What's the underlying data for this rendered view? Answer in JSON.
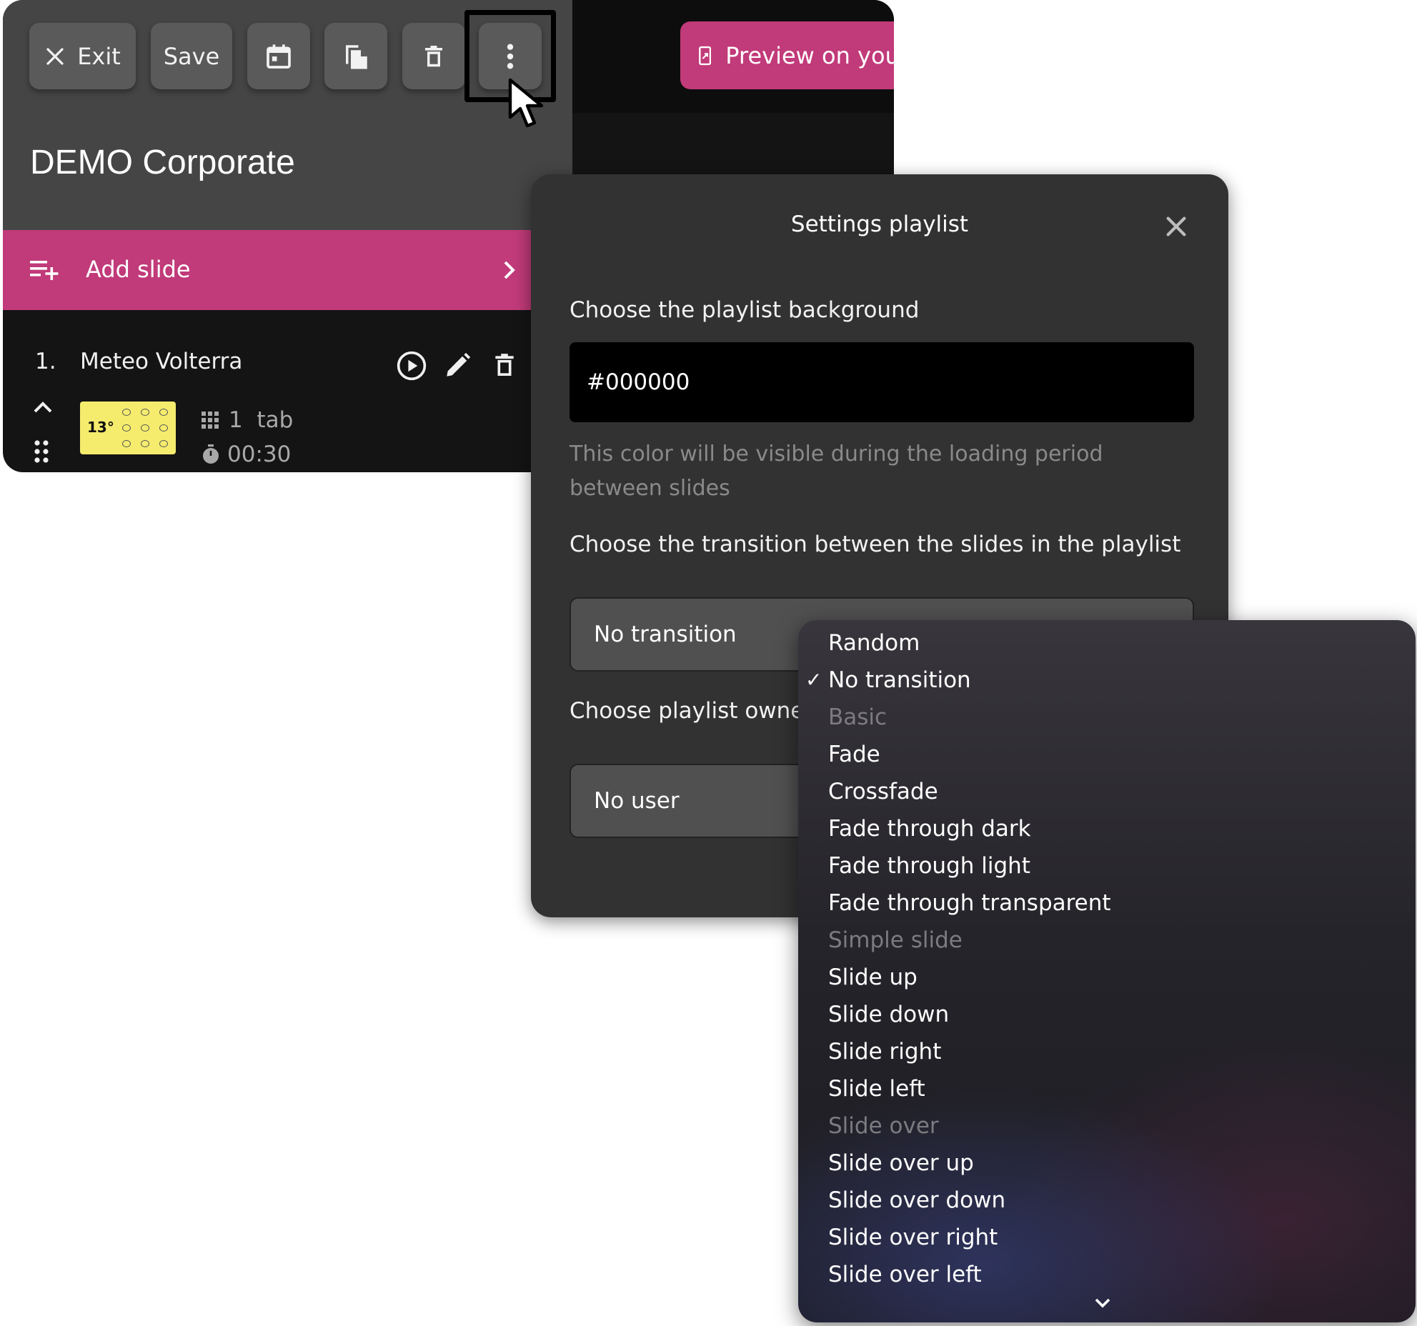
{
  "toolbar": {
    "exit_label": "Exit",
    "save_label": "Save",
    "preview_label": "Preview on your"
  },
  "playlist": {
    "title": "DEMO Corporate",
    "add_slide_label": "Add slide"
  },
  "slides": [
    {
      "index": "1.",
      "name": "Meteo Volterra",
      "tabs": "1  tab",
      "duration": "00:30",
      "thumb_temp": "13°"
    }
  ],
  "modal": {
    "title": "Settings playlist",
    "background_label": "Choose the playlist background",
    "background_value": "#000000",
    "background_help": "This color will be visible during the loading period between slides",
    "transition_label": "Choose the transition between the slides in the playlist",
    "transition_value": "No transition",
    "owner_label": "Choose playlist owner",
    "owner_value": "No user"
  },
  "dropdown": {
    "check_mark": "✓",
    "options": [
      {
        "label": "Random",
        "type": "option"
      },
      {
        "label": "No transition",
        "type": "option",
        "selected": true
      },
      {
        "label": "Basic",
        "type": "group"
      },
      {
        "label": "Fade",
        "type": "option"
      },
      {
        "label": "Crossfade",
        "type": "option"
      },
      {
        "label": "Fade through dark",
        "type": "option"
      },
      {
        "label": "Fade through light",
        "type": "option"
      },
      {
        "label": "Fade through transparent",
        "type": "option"
      },
      {
        "label": "Simple slide",
        "type": "group"
      },
      {
        "label": "Slide up",
        "type": "option"
      },
      {
        "label": "Slide down",
        "type": "option"
      },
      {
        "label": "Slide right",
        "type": "option"
      },
      {
        "label": "Slide left",
        "type": "option"
      },
      {
        "label": "Slide over",
        "type": "group"
      },
      {
        "label": "Slide over up",
        "type": "option"
      },
      {
        "label": "Slide over down",
        "type": "option"
      },
      {
        "label": "Slide over right",
        "type": "option"
      },
      {
        "label": "Slide over left",
        "type": "option"
      }
    ]
  },
  "colors": {
    "accent": "#c13a79",
    "panel": "#454545",
    "modal": "#323232",
    "list_bg": "#141414"
  },
  "icons": {
    "exit": "close-icon",
    "calendar": "calendar-icon",
    "copy": "copy-icon",
    "delete": "trash-icon",
    "more": "more-vertical-icon",
    "preview": "phone-share-icon",
    "add_slide": "playlist-add-icon",
    "play": "play-circle-icon",
    "edit": "pencil-icon",
    "drag": "drag-handle-icon",
    "tabs": "grid-icon",
    "timer": "timer-icon",
    "scroll_down": "chevron-down-icon"
  }
}
